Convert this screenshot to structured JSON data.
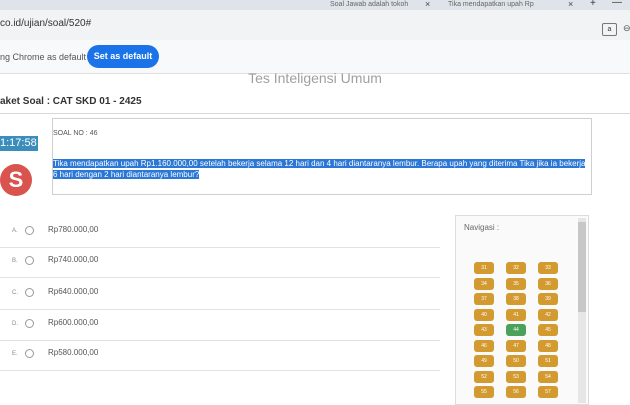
{
  "browser": {
    "tabs": [
      {
        "title": "Soal Jawab adalah tokoh"
      },
      {
        "title": "Tika mendapatkan upah Rp"
      }
    ],
    "close_glyph": "×",
    "window": {
      "minimize": "—",
      "new_tab": "+"
    },
    "url": "co.id/ujian/soal/520#",
    "translate_icon_glyph": "a",
    "extension_glyph": "⊖"
  },
  "infobar": {
    "text": "ng Chrome as default",
    "button_label": "Set as default"
  },
  "page": {
    "header": "Tes Inteligensi Umum",
    "paket_title": "aket Soal : CAT SKD 01 - 2425",
    "timer": "1:17:58",
    "logo_glyph": "S"
  },
  "question": {
    "number_label": "SOAL NO : 46",
    "text": "Tika mendapatkan upah Rp1.160.000,00 setelah bekerja selama 12 hari dan 4 hari diantaranya lembur. Berapa upah yang diterima Tika jika ia bekerja 6 hari dengan 2 hari diantaranya lembur?"
  },
  "options": [
    {
      "letter": "A.",
      "text": "Rp780.000,00"
    },
    {
      "letter": "B.",
      "text": "Rp740.000,00"
    },
    {
      "letter": "C.",
      "text": "Rp640.000,00"
    },
    {
      "letter": "D.",
      "text": "Rp600.000,00"
    },
    {
      "letter": "E.",
      "text": "Rp580.000,00"
    }
  ],
  "navigation": {
    "label": "Navigasi :",
    "numbers": [
      "31",
      "32",
      "33",
      "34",
      "35",
      "36",
      "37",
      "38",
      "39",
      "40",
      "41",
      "42",
      "43",
      "44",
      "45",
      "46",
      "47",
      "48",
      "49",
      "50",
      "51",
      "52",
      "53",
      "54",
      "55",
      "56",
      "57"
    ],
    "active_number": "44",
    "colors": {
      "answered": "#d39b2f",
      "active": "#4aa25a"
    }
  },
  "colors": {
    "accent": "#1a73e8",
    "timer": "#3c8dbc",
    "highlight": "#2b77d6"
  }
}
